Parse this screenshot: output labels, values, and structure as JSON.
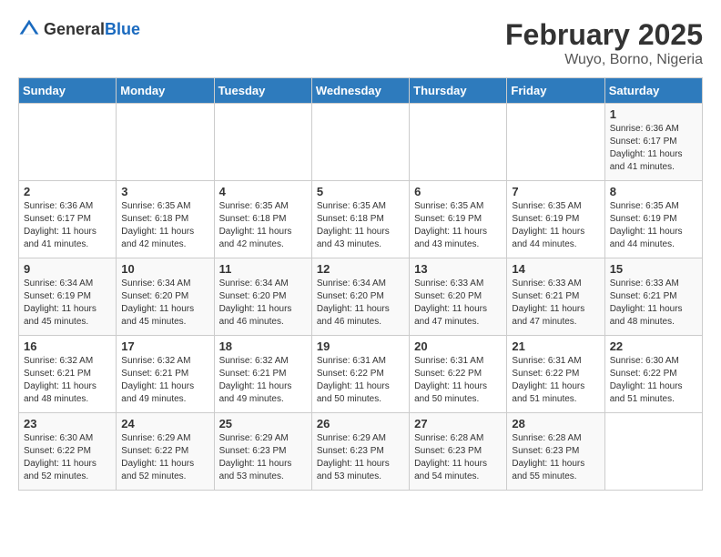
{
  "logo": {
    "general": "General",
    "blue": "Blue"
  },
  "title": "February 2025",
  "subtitle": "Wuyo, Borno, Nigeria",
  "weekdays": [
    "Sunday",
    "Monday",
    "Tuesday",
    "Wednesday",
    "Thursday",
    "Friday",
    "Saturday"
  ],
  "weeks": [
    [
      {
        "day": "",
        "info": ""
      },
      {
        "day": "",
        "info": ""
      },
      {
        "day": "",
        "info": ""
      },
      {
        "day": "",
        "info": ""
      },
      {
        "day": "",
        "info": ""
      },
      {
        "day": "",
        "info": ""
      },
      {
        "day": "1",
        "info": "Sunrise: 6:36 AM\nSunset: 6:17 PM\nDaylight: 11 hours and 41 minutes."
      }
    ],
    [
      {
        "day": "2",
        "info": "Sunrise: 6:36 AM\nSunset: 6:17 PM\nDaylight: 11 hours and 41 minutes."
      },
      {
        "day": "3",
        "info": "Sunrise: 6:35 AM\nSunset: 6:18 PM\nDaylight: 11 hours and 42 minutes."
      },
      {
        "day": "4",
        "info": "Sunrise: 6:35 AM\nSunset: 6:18 PM\nDaylight: 11 hours and 42 minutes."
      },
      {
        "day": "5",
        "info": "Sunrise: 6:35 AM\nSunset: 6:18 PM\nDaylight: 11 hours and 43 minutes."
      },
      {
        "day": "6",
        "info": "Sunrise: 6:35 AM\nSunset: 6:19 PM\nDaylight: 11 hours and 43 minutes."
      },
      {
        "day": "7",
        "info": "Sunrise: 6:35 AM\nSunset: 6:19 PM\nDaylight: 11 hours and 44 minutes."
      },
      {
        "day": "8",
        "info": "Sunrise: 6:35 AM\nSunset: 6:19 PM\nDaylight: 11 hours and 44 minutes."
      }
    ],
    [
      {
        "day": "9",
        "info": "Sunrise: 6:34 AM\nSunset: 6:19 PM\nDaylight: 11 hours and 45 minutes."
      },
      {
        "day": "10",
        "info": "Sunrise: 6:34 AM\nSunset: 6:20 PM\nDaylight: 11 hours and 45 minutes."
      },
      {
        "day": "11",
        "info": "Sunrise: 6:34 AM\nSunset: 6:20 PM\nDaylight: 11 hours and 46 minutes."
      },
      {
        "day": "12",
        "info": "Sunrise: 6:34 AM\nSunset: 6:20 PM\nDaylight: 11 hours and 46 minutes."
      },
      {
        "day": "13",
        "info": "Sunrise: 6:33 AM\nSunset: 6:20 PM\nDaylight: 11 hours and 47 minutes."
      },
      {
        "day": "14",
        "info": "Sunrise: 6:33 AM\nSunset: 6:21 PM\nDaylight: 11 hours and 47 minutes."
      },
      {
        "day": "15",
        "info": "Sunrise: 6:33 AM\nSunset: 6:21 PM\nDaylight: 11 hours and 48 minutes."
      }
    ],
    [
      {
        "day": "16",
        "info": "Sunrise: 6:32 AM\nSunset: 6:21 PM\nDaylight: 11 hours and 48 minutes."
      },
      {
        "day": "17",
        "info": "Sunrise: 6:32 AM\nSunset: 6:21 PM\nDaylight: 11 hours and 49 minutes."
      },
      {
        "day": "18",
        "info": "Sunrise: 6:32 AM\nSunset: 6:21 PM\nDaylight: 11 hours and 49 minutes."
      },
      {
        "day": "19",
        "info": "Sunrise: 6:31 AM\nSunset: 6:22 PM\nDaylight: 11 hours and 50 minutes."
      },
      {
        "day": "20",
        "info": "Sunrise: 6:31 AM\nSunset: 6:22 PM\nDaylight: 11 hours and 50 minutes."
      },
      {
        "day": "21",
        "info": "Sunrise: 6:31 AM\nSunset: 6:22 PM\nDaylight: 11 hours and 51 minutes."
      },
      {
        "day": "22",
        "info": "Sunrise: 6:30 AM\nSunset: 6:22 PM\nDaylight: 11 hours and 51 minutes."
      }
    ],
    [
      {
        "day": "23",
        "info": "Sunrise: 6:30 AM\nSunset: 6:22 PM\nDaylight: 11 hours and 52 minutes."
      },
      {
        "day": "24",
        "info": "Sunrise: 6:29 AM\nSunset: 6:22 PM\nDaylight: 11 hours and 52 minutes."
      },
      {
        "day": "25",
        "info": "Sunrise: 6:29 AM\nSunset: 6:23 PM\nDaylight: 11 hours and 53 minutes."
      },
      {
        "day": "26",
        "info": "Sunrise: 6:29 AM\nSunset: 6:23 PM\nDaylight: 11 hours and 53 minutes."
      },
      {
        "day": "27",
        "info": "Sunrise: 6:28 AM\nSunset: 6:23 PM\nDaylight: 11 hours and 54 minutes."
      },
      {
        "day": "28",
        "info": "Sunrise: 6:28 AM\nSunset: 6:23 PM\nDaylight: 11 hours and 55 minutes."
      },
      {
        "day": "",
        "info": ""
      }
    ]
  ]
}
